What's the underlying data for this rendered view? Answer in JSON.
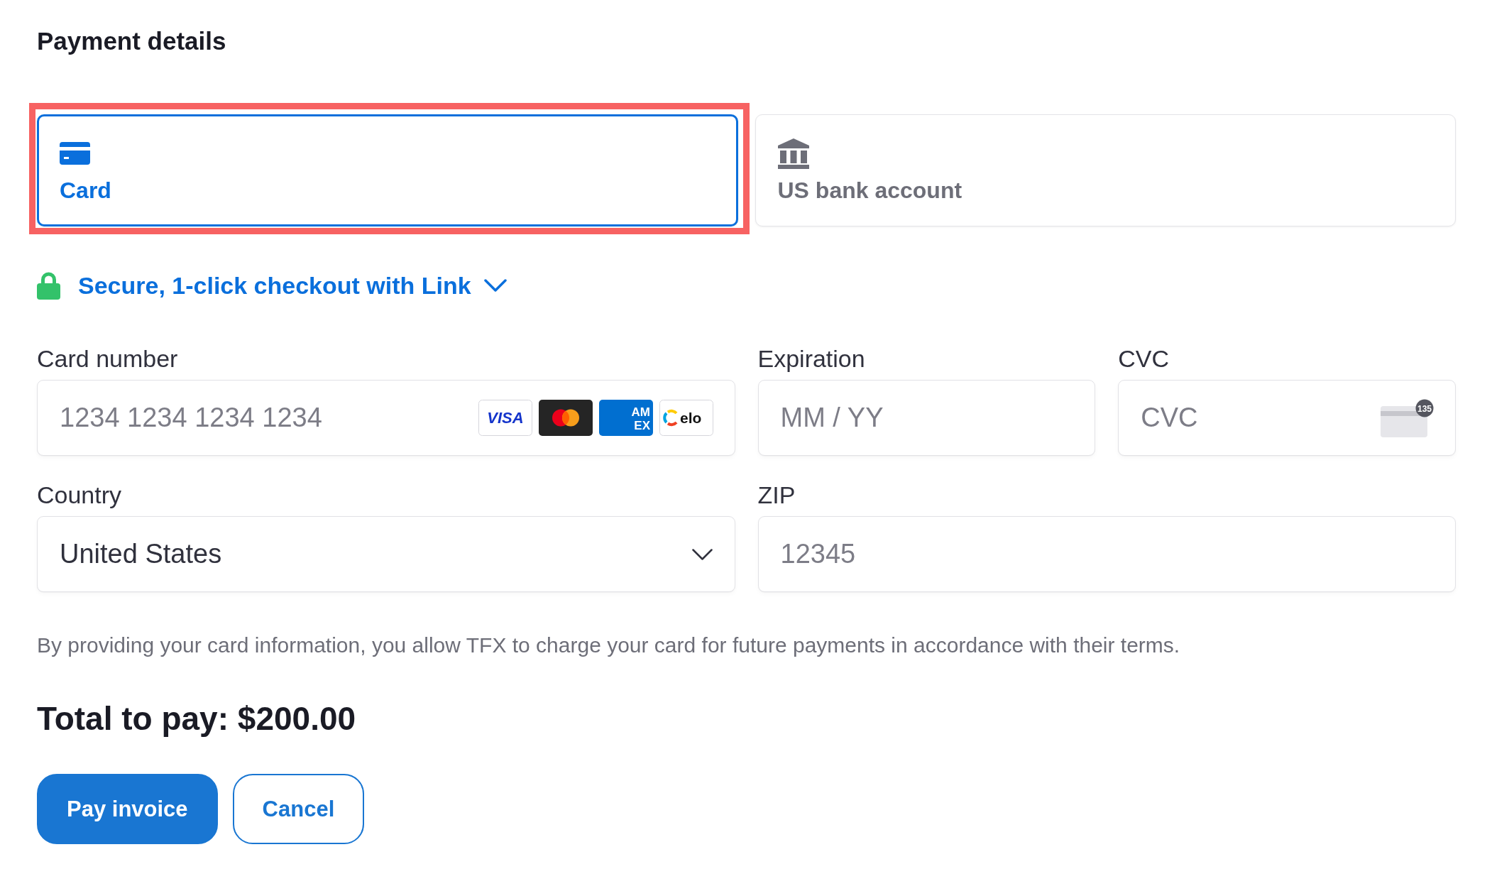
{
  "title": "Payment details",
  "tabs": [
    {
      "label": "Card",
      "kind": "card",
      "selected": true,
      "highlighted": true
    },
    {
      "label": "US bank account",
      "kind": "bank",
      "selected": false,
      "highlighted": false
    }
  ],
  "link": {
    "label": "Secure, 1-click checkout with Link",
    "expanded": false
  },
  "fields": [
    {
      "kind": "card_number",
      "label": "Card number",
      "placeholder": "1234 1234 1234 1234",
      "brands": [
        {
          "kind": "visa",
          "label": "VISA"
        },
        {
          "kind": "mastercard"
        },
        {
          "kind": "amex",
          "lines": [
            "AM",
            "EX"
          ]
        },
        {
          "kind": "elo",
          "label": "elo"
        }
      ]
    },
    {
      "kind": "expiry",
      "label": "Expiration",
      "placeholder": "MM / YY"
    },
    {
      "kind": "cvc",
      "label": "CVC",
      "placeholder": "CVC",
      "hint": "135"
    },
    {
      "kind": "select",
      "label": "Country",
      "value": "United States"
    },
    {
      "kind": "zip",
      "label": "ZIP",
      "placeholder": "12345"
    }
  ],
  "disclaimer": "By providing your card information, you allow TFX to charge your card for future payments in accordance with their terms.",
  "total": "Total to pay: $200.00",
  "buttons": [
    {
      "label": "Pay invoice",
      "kind": "primary"
    },
    {
      "label": "Cancel",
      "kind": "outline"
    }
  ]
}
